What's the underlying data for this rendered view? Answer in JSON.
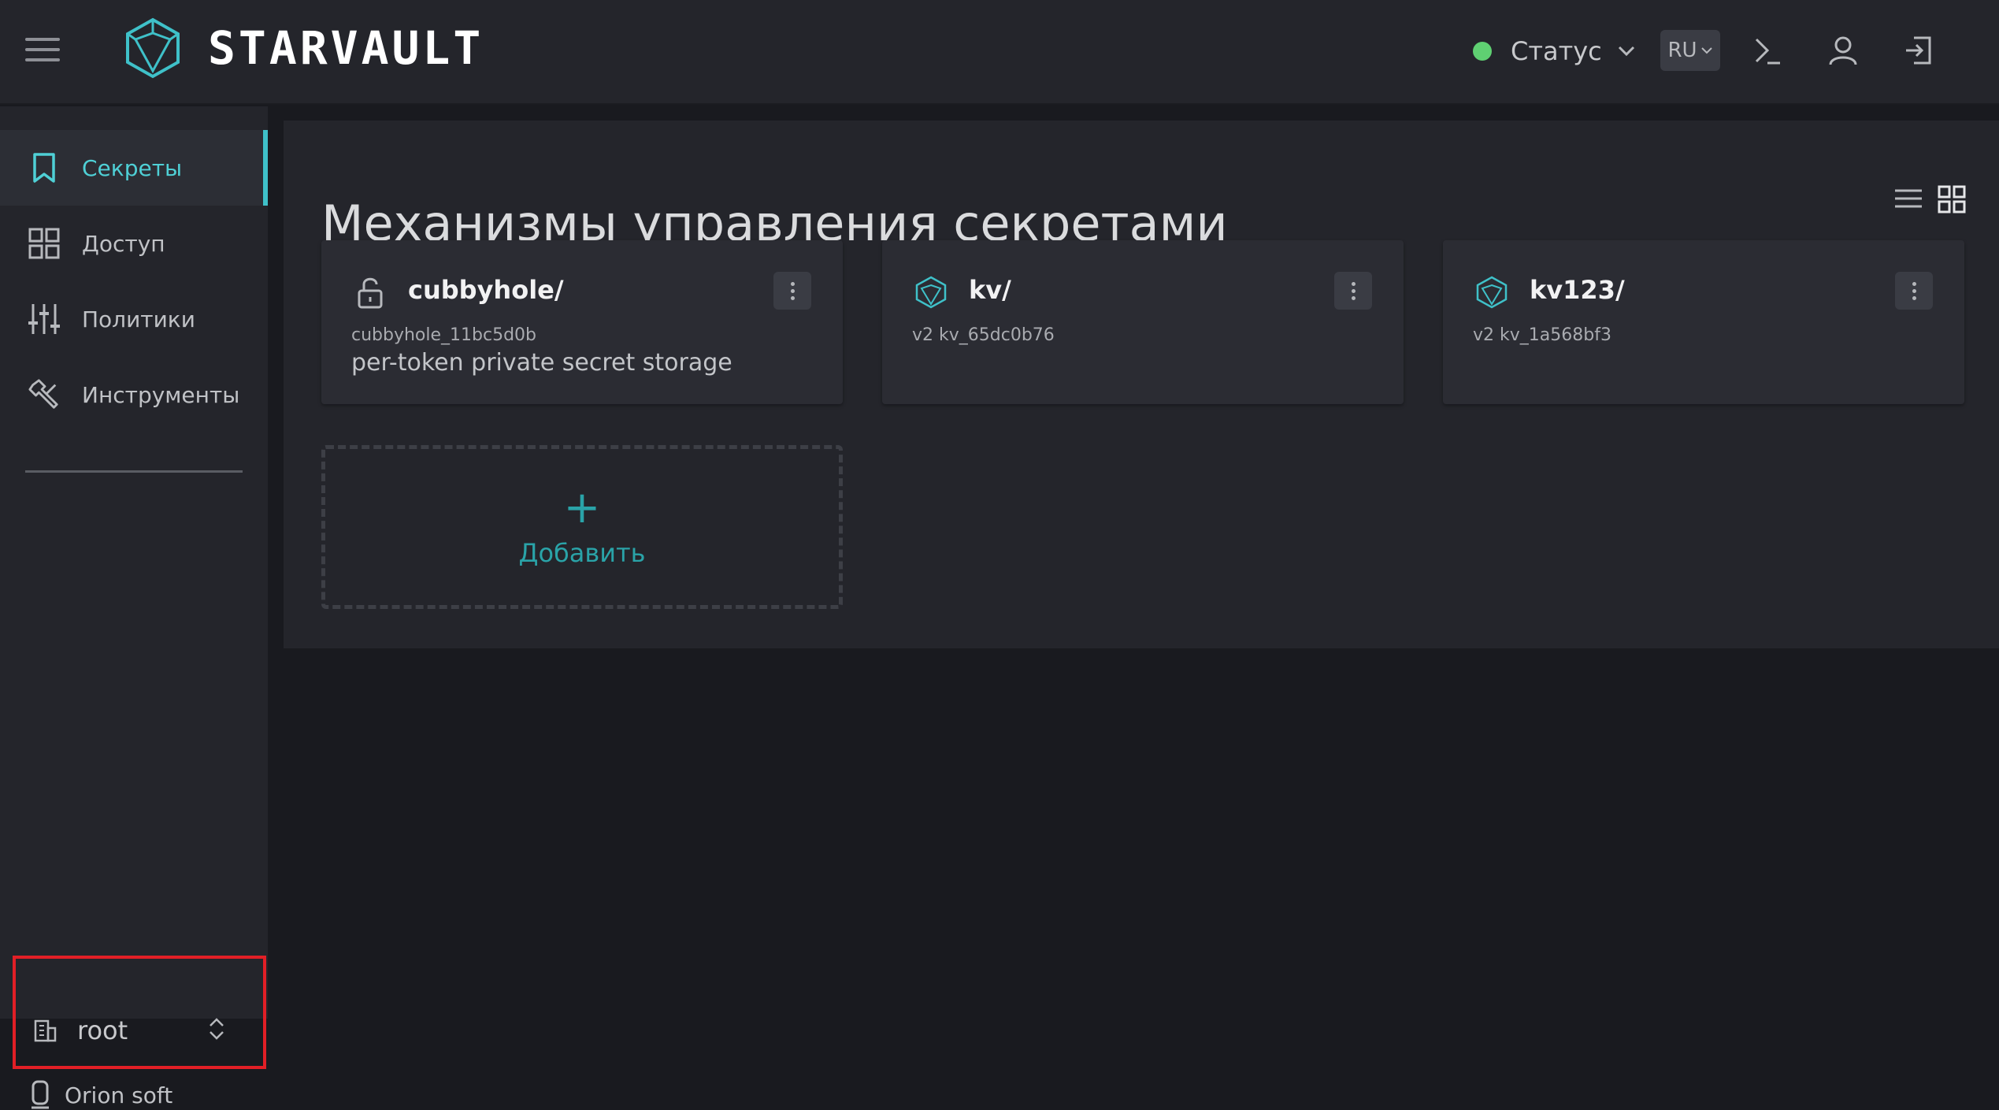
{
  "header": {
    "brand": "STARVAULT",
    "status_label": "Статус",
    "lang": "RU",
    "status_color": "#5fd072",
    "accent_color": "#3fc1c9",
    "icons": [
      "menu-icon",
      "terminal-icon",
      "user-icon",
      "logout-icon"
    ]
  },
  "sidebar": {
    "items": [
      {
        "label": "Секреты",
        "icon": "bookmark-icon",
        "active": true
      },
      {
        "label": "Доступ",
        "icon": "grid-icon"
      },
      {
        "label": "Политики",
        "icon": "sliders-icon"
      },
      {
        "label": "Инструменты",
        "icon": "tools-icon"
      }
    ],
    "namespace": "root",
    "org": "Orion soft"
  },
  "main": {
    "title": "Механизмы управления секретами",
    "cards": [
      {
        "name": "cubbyhole/",
        "sub": "cubbyhole_11bc5d0b",
        "desc": "per-token private secret storage",
        "icon": "unlock-icon"
      },
      {
        "name": "kv/",
        "sub": "v2 kv_65dc0b76",
        "desc": "",
        "icon": "kv-engine-icon"
      },
      {
        "name": "kv123/",
        "sub": "v2 kv_1a568bf3",
        "desc": "",
        "icon": "kv-engine-icon"
      }
    ],
    "add_plus": "+",
    "add_label": "Добавить"
  }
}
